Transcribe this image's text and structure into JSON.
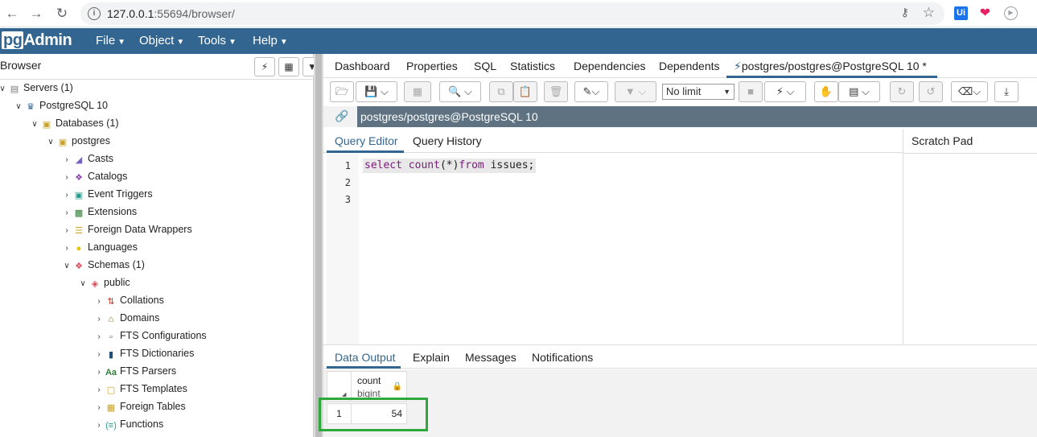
{
  "browser": {
    "url_host": "127.0.0.1",
    "url_rest": ":55694/browser/",
    "ext_ui_label": "Ui"
  },
  "navbar": {
    "logo_pg": "pg",
    "logo_rest": "Admin",
    "menus": [
      "File",
      "Object",
      "Tools",
      "Help"
    ]
  },
  "left": {
    "title": "Browser",
    "tree": [
      {
        "label": "Servers (1)"
      },
      {
        "label": "PostgreSQL 10"
      },
      {
        "label": "Databases (1)"
      },
      {
        "label": "postgres"
      },
      {
        "label": "Casts"
      },
      {
        "label": "Catalogs"
      },
      {
        "label": "Event Triggers"
      },
      {
        "label": "Extensions"
      },
      {
        "label": "Foreign Data Wrappers"
      },
      {
        "label": "Languages"
      },
      {
        "label": "Schemas (1)"
      },
      {
        "label": "public"
      },
      {
        "label": "Collations"
      },
      {
        "label": "Domains"
      },
      {
        "label": "FTS Configurations"
      },
      {
        "label": "FTS Dictionaries"
      },
      {
        "label": "FTS Parsers"
      },
      {
        "label": "FTS Templates"
      },
      {
        "label": "Foreign Tables"
      },
      {
        "label": "Functions"
      }
    ]
  },
  "main_tabs": [
    "Dashboard",
    "Properties",
    "SQL",
    "Statistics",
    "Dependencies",
    "Dependents",
    "postgres/postgres@PostgreSQL 10 *"
  ],
  "toolbar": {
    "limit_value": "No limit"
  },
  "connection": {
    "name": "postgres/postgres@PostgreSQL 10"
  },
  "query_tabs": [
    "Query Editor",
    "Query History"
  ],
  "scratch_pad": "Scratch Pad",
  "editor": {
    "line_numbers": [
      "1",
      "2",
      "3"
    ],
    "kw_select": "select",
    "fn_count": "count",
    "paren_open": "(",
    "star": "*",
    "paren_close": ")",
    "kw_from": "from",
    "table": "issues;"
  },
  "result_tabs": [
    "Data Output",
    "Explain",
    "Messages",
    "Notifications"
  ],
  "grid": {
    "column_name": "count",
    "column_type": "bigint",
    "rows": [
      {
        "row_num": "1",
        "value": "54"
      }
    ]
  }
}
